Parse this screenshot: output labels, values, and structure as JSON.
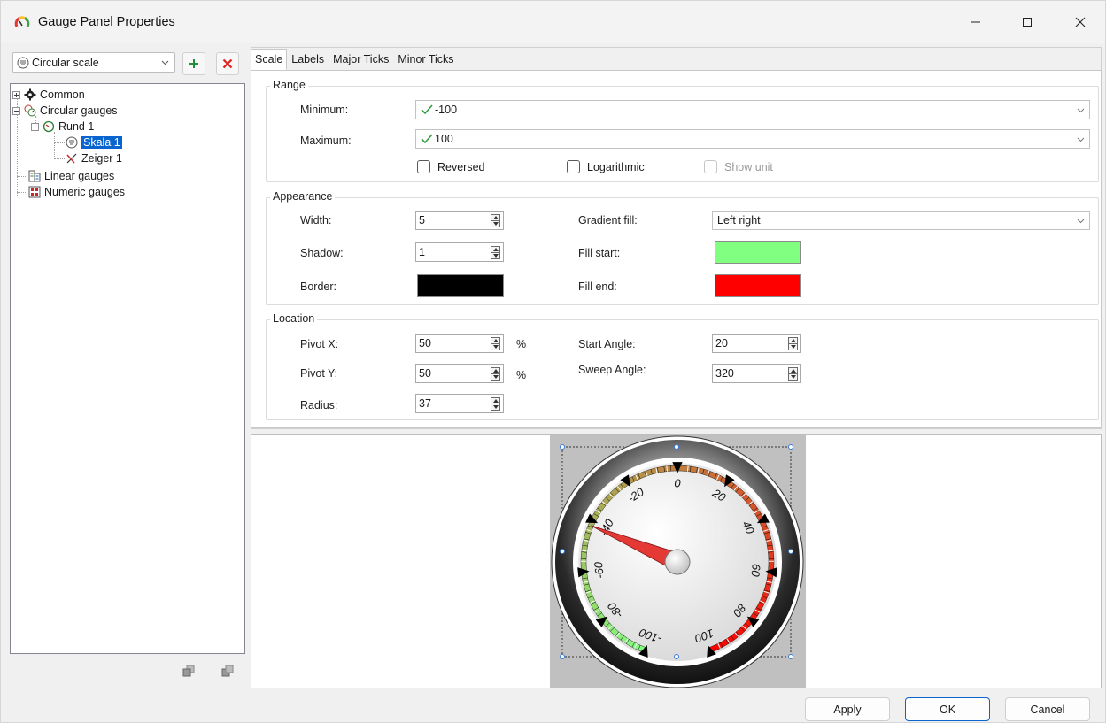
{
  "window": {
    "title": "Gauge Panel Properties",
    "icons": {
      "app": "gauge-app-icon",
      "minimize": "minimize-icon",
      "maximize": "maximize-icon",
      "close": "close-icon"
    }
  },
  "left_panel": {
    "scale_type": {
      "selected": "Circular scale",
      "icon": "circular-scale-icon"
    },
    "add_icon": "plus-icon",
    "delete_icon": "delete-x-icon",
    "tree": [
      {
        "label": "Common",
        "icon": "gear-icon",
        "expander": "plus"
      },
      {
        "label": "Circular gauges",
        "icon": "circular-gauges-icon",
        "expander": "minus"
      },
      {
        "label": "Rund 1",
        "icon": "gauge-icon",
        "expander": "minus"
      },
      {
        "label": "Skala 1",
        "icon": "scale-icon",
        "selected": true
      },
      {
        "label": "Zeiger 1",
        "icon": "needle-icon"
      },
      {
        "label": "Linear gauges",
        "icon": "linear-gauges-icon"
      },
      {
        "label": "Numeric gauges",
        "icon": "numeric-gauges-icon"
      }
    ],
    "footer_icons": [
      "move-up-icon",
      "move-down-icon"
    ]
  },
  "tabs": [
    "Scale",
    "Labels",
    "Major Ticks",
    "Minor Ticks"
  ],
  "range": {
    "title": "Range",
    "minimum_label": "Minimum:",
    "minimum_value": "-100",
    "maximum_label": "Maximum:",
    "maximum_value": "100",
    "reversed_label": "Reversed",
    "logarithmic_label": "Logarithmic",
    "show_unit_label": "Show unit"
  },
  "appearance": {
    "title": "Appearance",
    "width_label": "Width:",
    "width_value": "5",
    "shadow_label": "Shadow:",
    "shadow_value": "1",
    "border_label": "Border:",
    "border_color": "#000000",
    "gradient_fill_label": "Gradient fill:",
    "gradient_fill_value": "Left right",
    "fill_start_label": "Fill start:",
    "fill_start_color": "#80ff80",
    "fill_end_label": "Fill end:",
    "fill_end_color": "#ff0000"
  },
  "location": {
    "title": "Location",
    "pivot_x_label": "Pivot X:",
    "pivot_x_value": "50",
    "pivot_y_label": "Pivot Y:",
    "pivot_y_value": "50",
    "radius_label": "Radius:",
    "radius_value": "37",
    "percent": "%",
    "start_angle_label": "Start Angle:",
    "start_angle_value": "20",
    "sweep_angle_label": "Sweep Angle:",
    "sweep_angle_value": "320"
  },
  "preview": {
    "scale_labels": [
      "-100",
      "-80",
      "-60",
      "-40",
      "-20",
      "0",
      "20",
      "40",
      "60",
      "80",
      "100"
    ],
    "needle_value": -42
  },
  "buttons": {
    "apply": "Apply",
    "ok": "OK",
    "cancel": "Cancel"
  }
}
